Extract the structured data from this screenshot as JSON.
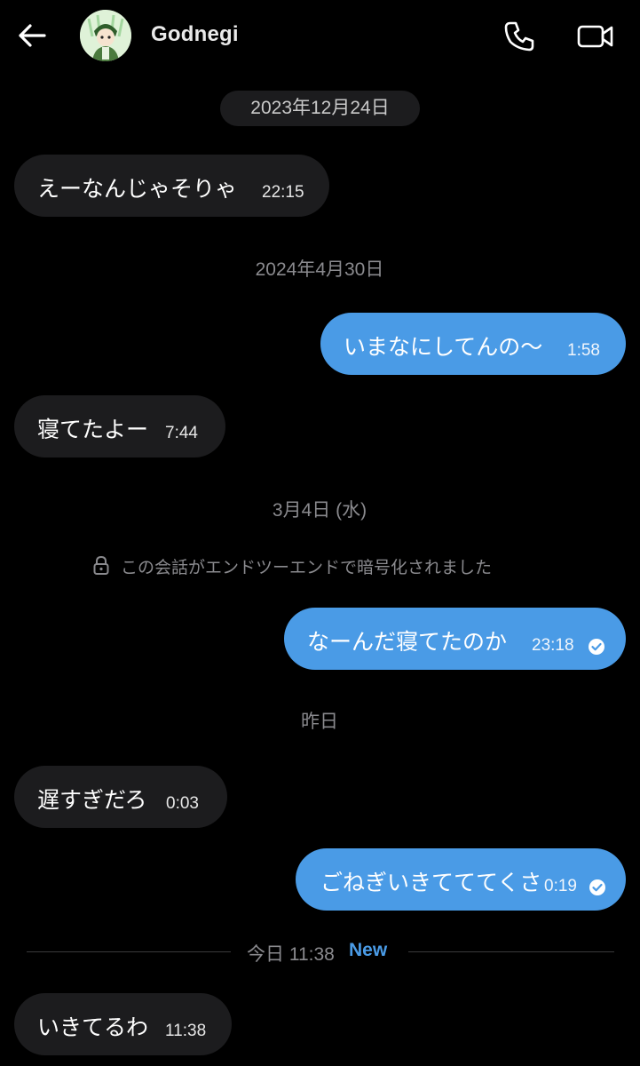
{
  "header": {
    "contact_name": "Godnegi",
    "back_icon": "arrow-left-icon",
    "call_icon": "phone-icon",
    "video_icon": "video-camera-icon"
  },
  "dates": {
    "d1": "2023年12月24日",
    "d2": "2024年4月30日",
    "d3": "3月4日 (水)",
    "d4": "昨日"
  },
  "encryption_notice": "この会話がエンドツーエンドで暗号化されました",
  "today_divider": {
    "label": "今日 11:38",
    "new_label": "New"
  },
  "messages": [
    {
      "text": "えーなんじゃそりゃ",
      "time": "22:15",
      "direction": "incoming"
    },
    {
      "text": "いまなにしてんの〜",
      "time": "1:58",
      "direction": "outgoing"
    },
    {
      "text": "寝てたよー",
      "time": "7:44",
      "direction": "incoming"
    },
    {
      "text": "なーんだ寝てたのか",
      "time": "23:18",
      "direction": "outgoing",
      "read": true
    },
    {
      "text": "遅すぎだろ",
      "time": "0:03",
      "direction": "incoming"
    },
    {
      "text": "ごねぎいきてててくさ",
      "time": "0:19",
      "direction": "outgoing",
      "read": true
    },
    {
      "text": "いきてるわ",
      "time": "11:38",
      "direction": "incoming"
    }
  ],
  "colors": {
    "background": "#000000",
    "incoming_bubble": "#1c1c1e",
    "outgoing_bubble": "#4a9be6",
    "muted_text": "#8a8a8e",
    "new_accent": "#4a9be6"
  }
}
